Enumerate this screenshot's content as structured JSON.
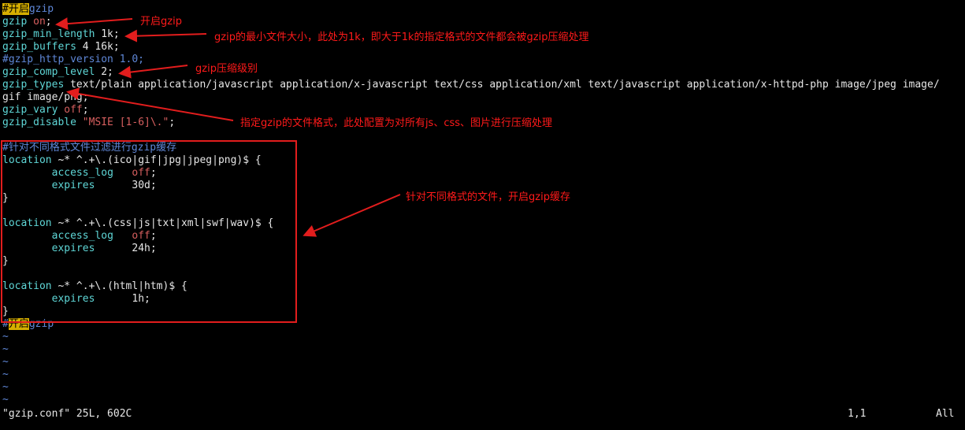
{
  "editor": {
    "lines": [
      {
        "parts": [
          {
            "c": "hl",
            "t": "#开启"
          },
          {
            "c": "cmt",
            "t": "gzip"
          }
        ]
      },
      {
        "parts": [
          {
            "c": "dir",
            "t": "gzip"
          },
          {
            "c": "val",
            "t": " "
          },
          {
            "c": "str",
            "t": "on"
          },
          {
            "c": "val",
            "t": ";"
          }
        ]
      },
      {
        "parts": [
          {
            "c": "dir",
            "t": "gzip_min_length"
          },
          {
            "c": "val",
            "t": " 1k;"
          }
        ]
      },
      {
        "parts": [
          {
            "c": "dir",
            "t": "gzip_buffers"
          },
          {
            "c": "val",
            "t": " 4 16k;"
          }
        ]
      },
      {
        "parts": [
          {
            "c": "cmt",
            "t": "#gzip_http_version 1.0;"
          }
        ]
      },
      {
        "parts": [
          {
            "c": "dir",
            "t": "gzip_comp_level"
          },
          {
            "c": "val",
            "t": " 2;"
          }
        ]
      },
      {
        "parts": [
          {
            "c": "dir",
            "t": "gzip_types"
          },
          {
            "c": "val",
            "t": " text/plain application/javascript application/x-javascript text/css application/xml text/javascript application/x-httpd-php image/jpeg image/"
          }
        ]
      },
      {
        "parts": [
          {
            "c": "val",
            "t": "gif image/png;"
          }
        ]
      },
      {
        "parts": [
          {
            "c": "dir",
            "t": "gzip_vary"
          },
          {
            "c": "val",
            "t": " "
          },
          {
            "c": "str",
            "t": "off"
          },
          {
            "c": "val",
            "t": ";"
          }
        ]
      },
      {
        "parts": [
          {
            "c": "dir",
            "t": "gzip_disable"
          },
          {
            "c": "val",
            "t": " "
          },
          {
            "c": "str",
            "t": "\"MSIE [1-6]\\.\""
          },
          {
            "c": "val",
            "t": ";"
          }
        ]
      },
      {
        "parts": []
      },
      {
        "parts": [
          {
            "c": "cmt",
            "t": "#针对不同格式文件过滤进行gzip缓存"
          }
        ]
      },
      {
        "parts": [
          {
            "c": "dir",
            "t": "location"
          },
          {
            "c": "val",
            "t": " ~* ^.+\\.(ico|gif|jpg|jpeg|png)$ {"
          }
        ]
      },
      {
        "parts": [
          {
            "c": "val",
            "t": "        "
          },
          {
            "c": "dir",
            "t": "access_log"
          },
          {
            "c": "val",
            "t": "   "
          },
          {
            "c": "str",
            "t": "off"
          },
          {
            "c": "val",
            "t": ";"
          }
        ]
      },
      {
        "parts": [
          {
            "c": "val",
            "t": "        "
          },
          {
            "c": "dir",
            "t": "expires"
          },
          {
            "c": "val",
            "t": "      30d;"
          }
        ]
      },
      {
        "parts": [
          {
            "c": "val",
            "t": "}"
          }
        ]
      },
      {
        "parts": []
      },
      {
        "parts": [
          {
            "c": "dir",
            "t": "location"
          },
          {
            "c": "val",
            "t": " ~* ^.+\\.(css|js|txt|xml|swf|wav)$ {"
          }
        ]
      },
      {
        "parts": [
          {
            "c": "val",
            "t": "        "
          },
          {
            "c": "dir",
            "t": "access_log"
          },
          {
            "c": "val",
            "t": "   "
          },
          {
            "c": "str",
            "t": "off"
          },
          {
            "c": "val",
            "t": ";"
          }
        ]
      },
      {
        "parts": [
          {
            "c": "val",
            "t": "        "
          },
          {
            "c": "dir",
            "t": "expires"
          },
          {
            "c": "val",
            "t": "      24h;"
          }
        ]
      },
      {
        "parts": [
          {
            "c": "val",
            "t": "}"
          }
        ]
      },
      {
        "parts": []
      },
      {
        "parts": [
          {
            "c": "dir",
            "t": "location"
          },
          {
            "c": "val",
            "t": " ~* ^.+\\.(html|htm)$ {"
          }
        ]
      },
      {
        "parts": [
          {
            "c": "val",
            "t": "        "
          },
          {
            "c": "dir",
            "t": "expires"
          },
          {
            "c": "val",
            "t": "      1h;"
          }
        ]
      },
      {
        "parts": [
          {
            "c": "val",
            "t": "}"
          }
        ]
      },
      {
        "parts": [
          {
            "c": "cmt",
            "t": "#"
          },
          {
            "c": "hl",
            "t": "开启"
          },
          {
            "c": "cmt",
            "t": "gzip"
          }
        ]
      },
      {
        "parts": [
          {
            "c": "tilde",
            "t": "~"
          }
        ]
      },
      {
        "parts": [
          {
            "c": "tilde",
            "t": "~"
          }
        ]
      },
      {
        "parts": [
          {
            "c": "tilde",
            "t": "~"
          }
        ]
      },
      {
        "parts": [
          {
            "c": "tilde",
            "t": "~"
          }
        ]
      },
      {
        "parts": [
          {
            "c": "tilde",
            "t": "~"
          }
        ]
      },
      {
        "parts": [
          {
            "c": "tilde",
            "t": "~"
          }
        ]
      }
    ]
  },
  "status": {
    "file": "\"gzip.conf\" 25L, 602C",
    "position": "1,1",
    "scroll": "All"
  },
  "annotations": {
    "gzip_on": "开启gzip",
    "min_length": "gzip的最小文件大小，此处为1k，即大于1k的指定格式的文件都会被gzip压缩处理",
    "comp_level": "gzip压缩级别",
    "types": "指定gzip的文件格式，此处配置为对所有js、css、图片进行压缩处理",
    "cache": "针对不同格式的文件，开启gzip缓存"
  },
  "colors": {
    "background": "#000000",
    "directive": "#5fd7d7",
    "string": "#d75f5f",
    "comment": "#5f87d7",
    "highlight": "#d7af00",
    "annotation": "#ff1a1a"
  }
}
